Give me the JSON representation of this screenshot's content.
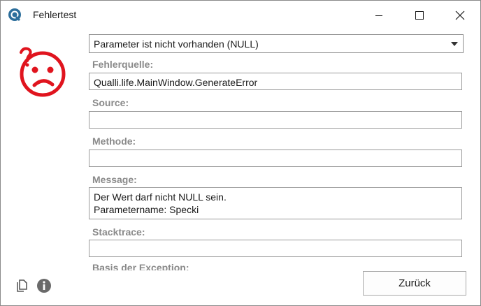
{
  "window": {
    "title": "Fehlertest"
  },
  "error_type": {
    "selected": "Parameter ist nicht vorhanden (NULL)"
  },
  "fields": {
    "fehlerquelle": {
      "label": "Fehlerquelle:",
      "value": "Qualli.life.MainWindow.GenerateError"
    },
    "source": {
      "label": "Source:",
      "value": ""
    },
    "methode": {
      "label": "Methode:",
      "value": ""
    },
    "message": {
      "label": "Message:",
      "value": "Der Wert darf nicht NULL sein.\nParametername: Specki"
    },
    "stacktrace": {
      "label": "Stacktrace:",
      "value": ""
    },
    "clipped_label": "Basis der Exception:"
  },
  "actions": {
    "back_label": "Zurück"
  },
  "icons": {
    "app": "qualli-app-icon",
    "smiley": "confused-smiley-icon",
    "copy": "copy-icon",
    "info": "info-icon"
  },
  "colors": {
    "smiley": "#e0141e",
    "label": "#8a8a8a"
  }
}
